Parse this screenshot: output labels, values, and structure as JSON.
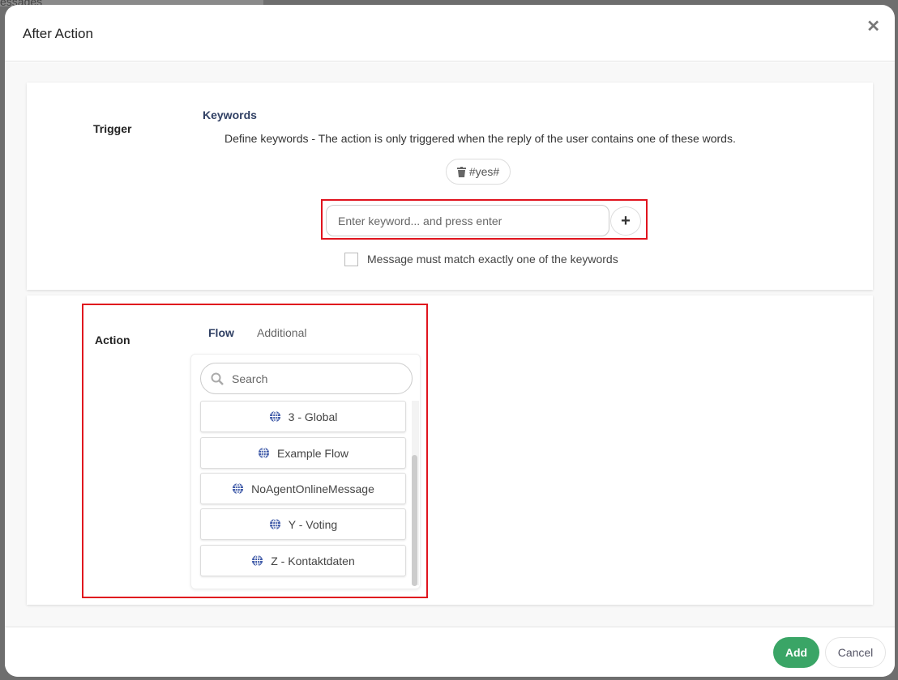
{
  "background": {
    "text": "essages"
  },
  "dialog": {
    "title": "After Action",
    "close_icon": "close-icon"
  },
  "trigger": {
    "label": "Trigger",
    "keywords_heading": "Keywords",
    "description": "Define keywords - The action is only triggered when the reply of the user contains one of these words.",
    "keywords": [
      {
        "text": "#yes#",
        "icon": "trash-icon"
      }
    ],
    "input_placeholder": "Enter keyword... and press enter",
    "add_icon": "plus-icon",
    "exact_match_label": "Message must match exactly one of the keywords",
    "exact_match_checked": false
  },
  "action": {
    "label": "Action",
    "tabs": [
      {
        "label": "Flow",
        "active": true
      },
      {
        "label": "Additional",
        "active": false
      }
    ],
    "search_placeholder": "Search",
    "flows": [
      {
        "label": "3 - Global"
      },
      {
        "label": "Example Flow"
      },
      {
        "label": "NoAgentOnlineMessage"
      },
      {
        "label": "Y - Voting"
      },
      {
        "label": "Z - Kontaktdaten"
      }
    ]
  },
  "footer": {
    "add_label": "Add",
    "cancel_label": "Cancel"
  },
  "colors": {
    "primary": "#3aa566",
    "highlight": "#e0141e",
    "heading": "#2f3f63",
    "globe": "#3f5aa8"
  }
}
